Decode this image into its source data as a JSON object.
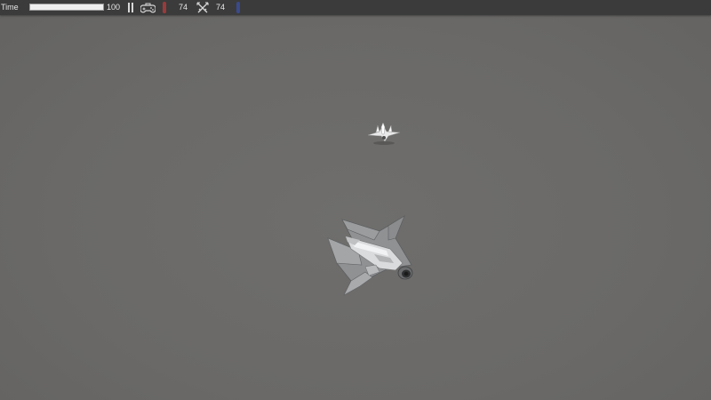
{
  "hud": {
    "time_label": "Time",
    "time_value": "100",
    "time_fraction": 1.0,
    "player1": {
      "score": "74",
      "icon": "gamepad-icon",
      "marker_color": "#9b3a3a"
    },
    "player2": {
      "score": "74",
      "icon": "crossed-swords-icon",
      "marker_color": "#3a4a8b"
    },
    "pause_icon": "pause-icon"
  },
  "scene": {
    "background_color": "#6b6a68",
    "enemy": {
      "icon": "enemy-ship-icon"
    },
    "player": {
      "icon": "player-ship-icon"
    }
  }
}
